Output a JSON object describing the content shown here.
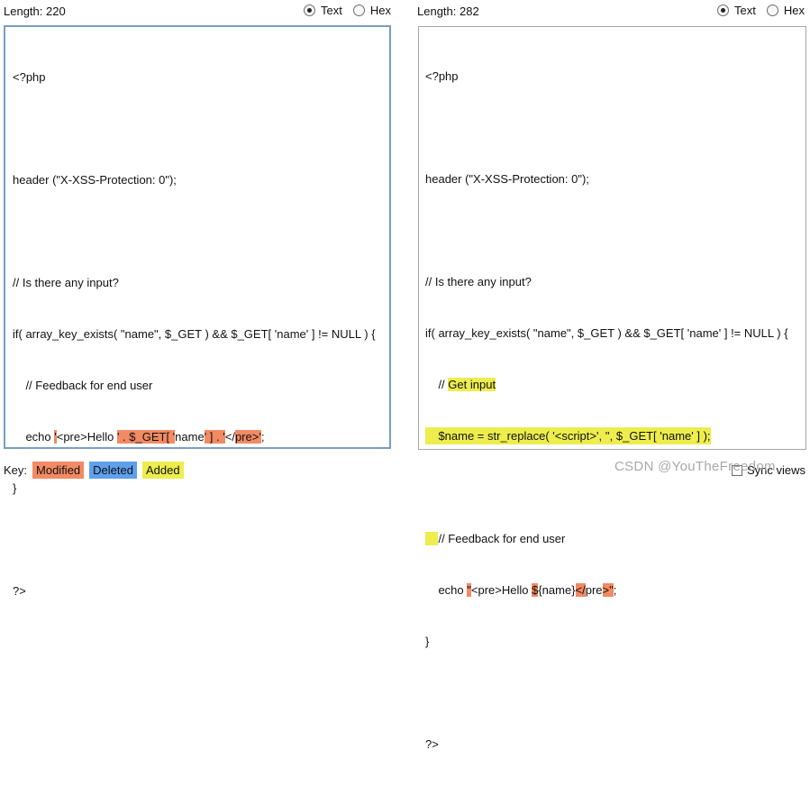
{
  "left": {
    "length_label": "Length: 220",
    "mode_text": "Text",
    "mode_hex": "Hex",
    "lines": {
      "l1": "<?php",
      "l3": "header (\"X-XSS-Protection: 0\");",
      "l5": "// Is there any input?",
      "l6": "if( array_key_exists( \"name\", $_GET ) && $_GET[ 'name' ] != NULL ) {",
      "l7": "    // Feedback for end user",
      "l8_a": "    echo ",
      "l8_m1": "'",
      "l8_b": "<pre>Hello ",
      "l8_m2": "' . $_GET[ '",
      "l8_c": "name",
      "l8_m3": "' ] . '",
      "l8_d": "</",
      "l8_e": "pre",
      "l8_m4": ">'",
      "l8_f": ";",
      "l9": "}",
      "l11": "?>"
    }
  },
  "right": {
    "length_label": "Length: 282",
    "mode_text": "Text",
    "mode_hex": "Hex",
    "lines": {
      "l1": "<?php",
      "l3": "header (\"X-XSS-Protection: 0\");",
      "l5": "// Is there any input?",
      "l6": "if( array_key_exists( \"name\", $_GET ) && $_GET[ 'name' ] != NULL ) {",
      "l7_a": "    // ",
      "l7_add": "Get input",
      "l8_add": "    $name = str_replace( '<script>', '', $_GET[ 'name' ] );",
      "l10_add": "    ",
      "l10_b": "// Feedback for end user",
      "l11_a": "    echo ",
      "l11_m1": "\"",
      "l11_b": "<pre>Hello ",
      "l11_m2": "$",
      "l11_c": "{name}",
      "l11_m3": "</",
      "l11_d": "pre",
      "l11_m4": ">\"",
      "l11_e": ";",
      "l12": "}",
      "l14": "?>"
    }
  },
  "key": {
    "label": "Key:",
    "modified": "Modified",
    "deleted": "Deleted",
    "added": "Added"
  },
  "sync_views": "Sync views",
  "watermark": "CSDN @YouTheFreedom",
  "colors": {
    "modified": "#f28a63",
    "deleted": "#5ea0ec",
    "added": "#eded4d"
  }
}
